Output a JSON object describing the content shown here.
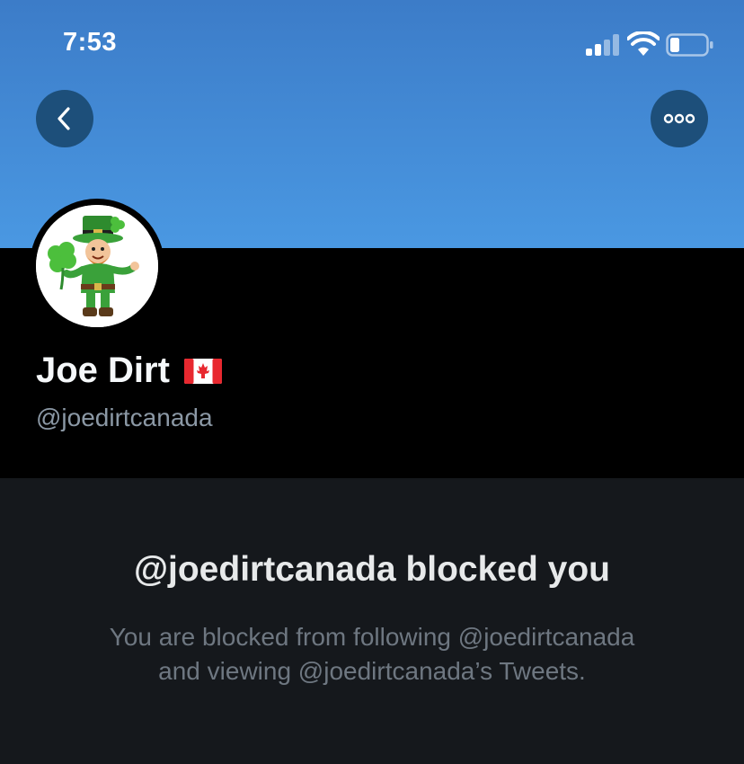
{
  "status_bar": {
    "time": "7:53"
  },
  "header": {
    "back_icon": "chevron-left-icon",
    "more_icon": "ellipsis-icon"
  },
  "profile": {
    "display_name": "Joe Dirt",
    "flag_icon": "canada-flag-icon",
    "handle": "@joedirtcanada",
    "avatar_icon": "leprechaun-avatar"
  },
  "blocked": {
    "title": "@joedirtcanada blocked you",
    "line1": "You are blocked from following @joedirtcanada",
    "line2": "and viewing @joedirtcanada’s Tweets."
  },
  "colors": {
    "banner": "#4a98e2",
    "button_bg": "#1d4f7a",
    "blocked_bg": "#15181c",
    "muted_text": "#6e7781"
  }
}
